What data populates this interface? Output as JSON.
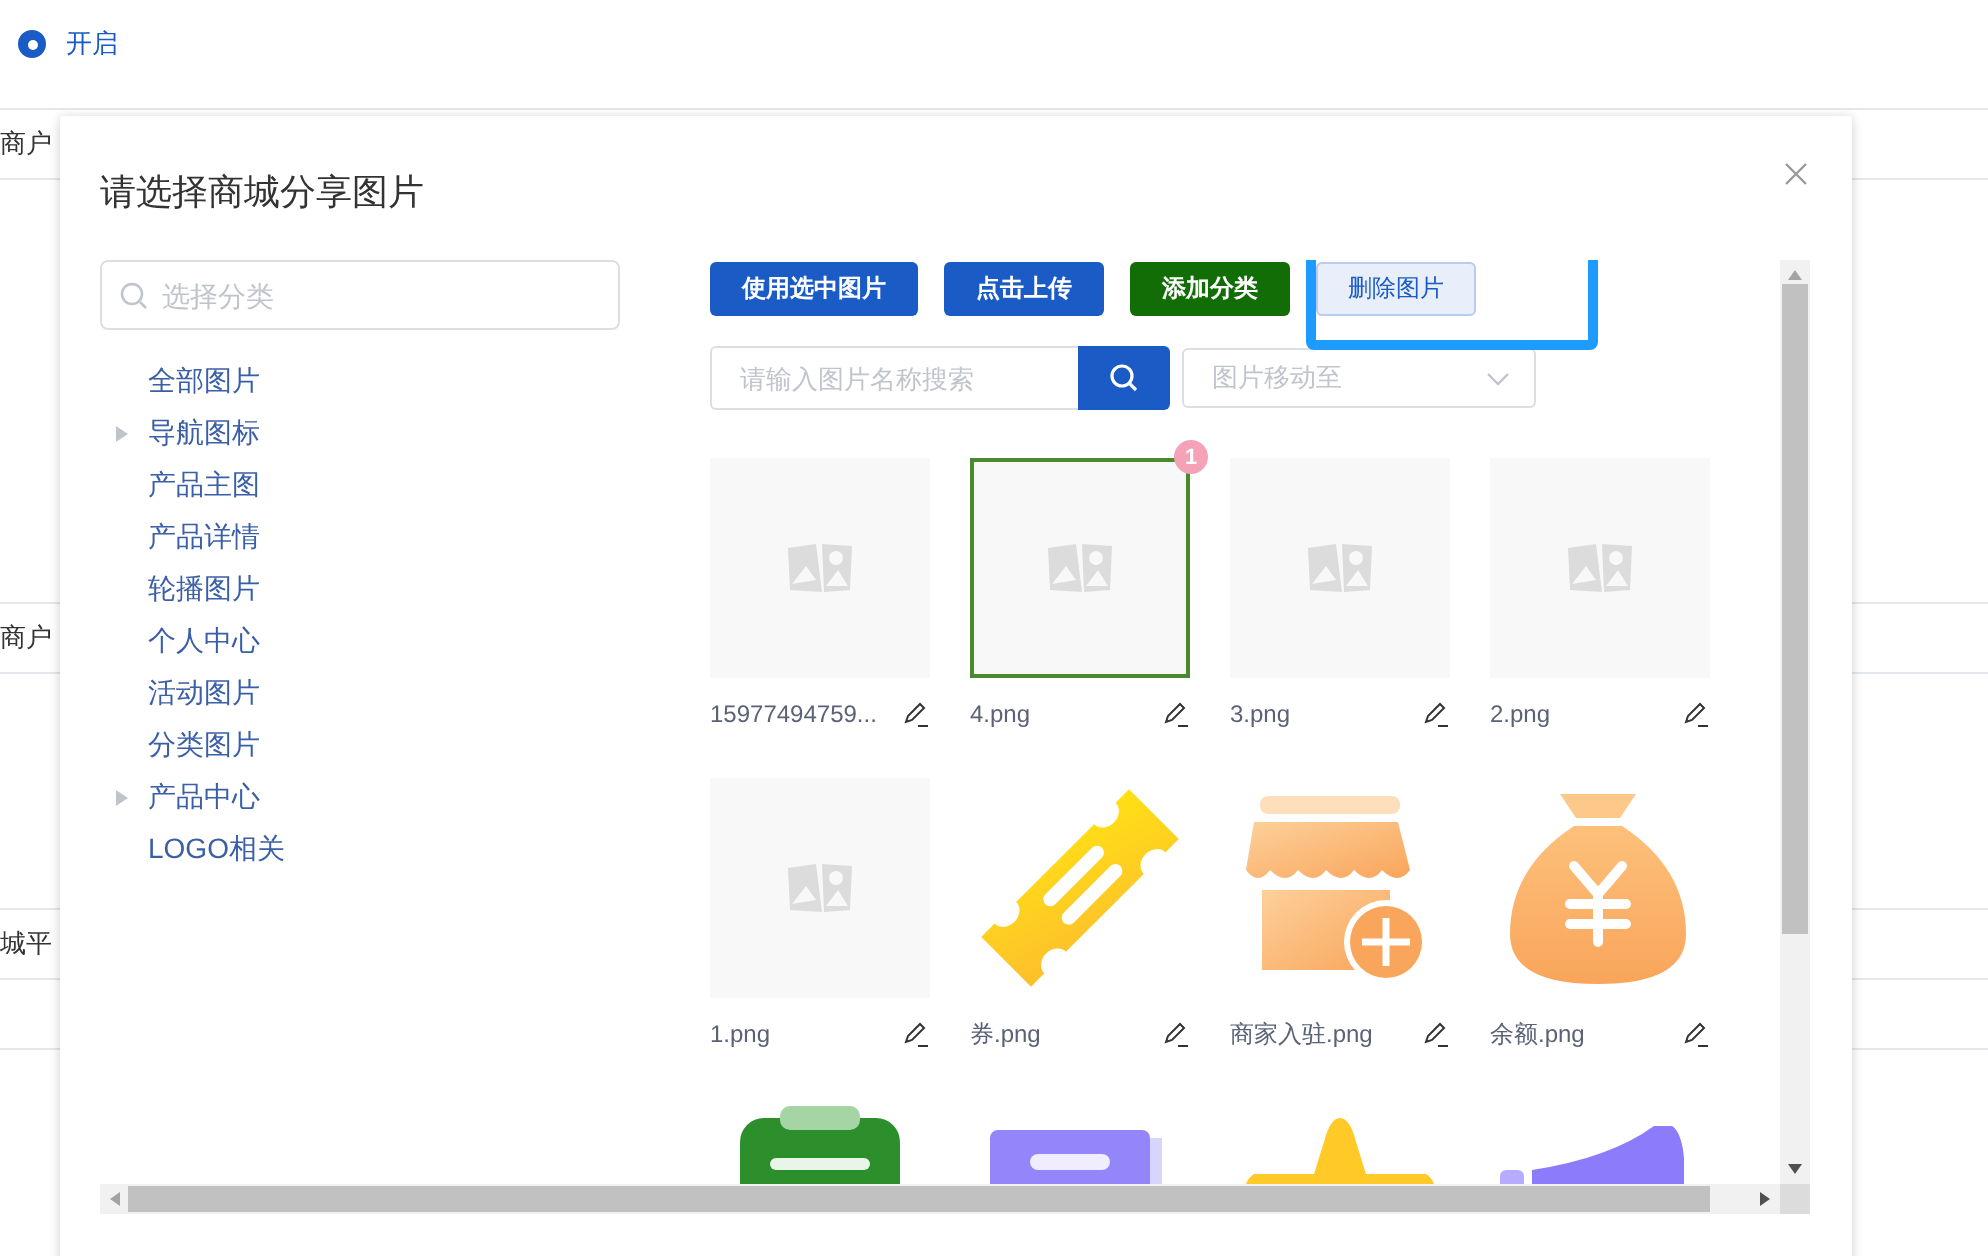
{
  "background": {
    "radio": {
      "label": "开启",
      "checked": true
    },
    "rows": [
      {
        "text": "商户"
      },
      {
        "text": "商户"
      },
      {
        "text": "城平"
      },
      {
        "text": ""
      }
    ]
  },
  "dialog": {
    "title": "请选择商城分享图片",
    "category_search": {
      "placeholder": "选择分类"
    },
    "categories": [
      {
        "label": "全部图片",
        "expandable": false
      },
      {
        "label": "导航图标",
        "expandable": true
      },
      {
        "label": "产品主图",
        "expandable": false
      },
      {
        "label": "产品详情",
        "expandable": false
      },
      {
        "label": "轮播图片",
        "expandable": false
      },
      {
        "label": "个人中心",
        "expandable": false
      },
      {
        "label": "活动图片",
        "expandable": false
      },
      {
        "label": "分类图片",
        "expandable": false
      },
      {
        "label": "产品中心",
        "expandable": true
      },
      {
        "label": "LOGO相关",
        "expandable": false
      }
    ],
    "buttons": [
      {
        "label": "使用选中图片",
        "kind": "primary",
        "highlighted": false
      },
      {
        "label": "点击上传",
        "kind": "primary",
        "highlighted": false
      },
      {
        "label": "添加分类",
        "kind": "success",
        "highlighted": false
      },
      {
        "label": "删除图片",
        "kind": "light",
        "highlighted": true
      }
    ],
    "image_search": {
      "placeholder": "请输入图片名称搜索"
    },
    "move_select": {
      "placeholder": "图片移动至"
    },
    "images": [
      {
        "name": "15977494759...",
        "kind": "placeholder",
        "selected": false
      },
      {
        "name": "4.png",
        "kind": "placeholder",
        "selected": true,
        "badge": "1"
      },
      {
        "name": "3.png",
        "kind": "placeholder",
        "selected": false
      },
      {
        "name": "2.png",
        "kind": "placeholder",
        "selected": false
      },
      {
        "name": "1.png",
        "kind": "placeholder",
        "selected": false
      },
      {
        "name": "券.png",
        "kind": "ticket",
        "selected": false
      },
      {
        "name": "商家入驻.png",
        "kind": "shop",
        "selected": false
      },
      {
        "name": "余额.png",
        "kind": "moneybag",
        "selected": false
      },
      {
        "kind": "clipboard",
        "selected": false
      },
      {
        "kind": "card",
        "selected": false
      },
      {
        "kind": "star",
        "selected": false
      },
      {
        "kind": "megaphone",
        "selected": false
      }
    ]
  }
}
